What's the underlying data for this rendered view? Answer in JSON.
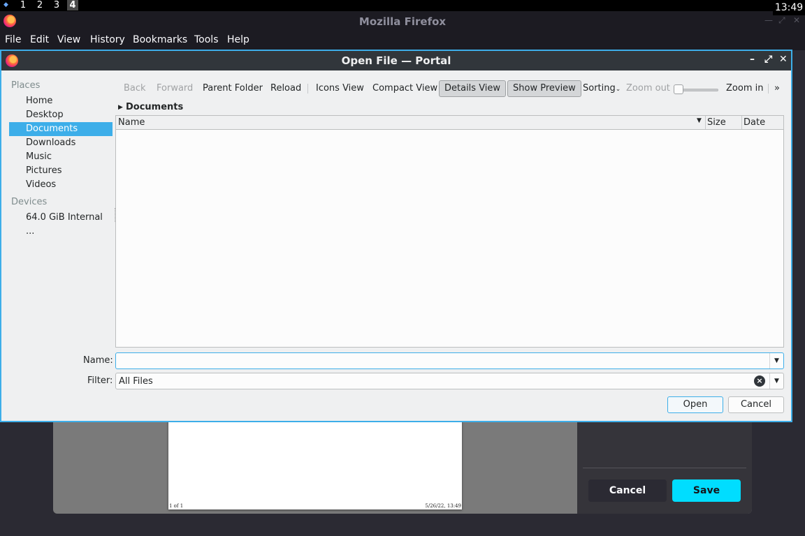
{
  "panel": {
    "workspaces": [
      "1",
      "2",
      "3",
      "4"
    ],
    "active_workspace": "4",
    "clock": "13:49"
  },
  "firefox": {
    "title": "Mozilla Firefox",
    "menu": [
      "File",
      "Edit",
      "View",
      "History",
      "Bookmarks",
      "Tools",
      "Help"
    ]
  },
  "background_page": {
    "footer_left": "1 of 1",
    "footer_right": "5/26/22, 13:49",
    "cancel_label": "Cancel",
    "save_label": "Save",
    "save_color": "#00ddff"
  },
  "dialog": {
    "title": "Open File — Portal",
    "places_header": "Places",
    "places": [
      "Home",
      "Desktop",
      "Documents",
      "Downloads",
      "Music",
      "Pictures",
      "Videos"
    ],
    "selected_place": "Documents",
    "devices_header": "Devices",
    "devices": [
      "64.0 GiB Internal ..."
    ],
    "toolbar": {
      "back": "Back",
      "forward": "Forward",
      "parent": "Parent Folder",
      "reload": "Reload",
      "icons_view": "Icons View",
      "compact_view": "Compact View",
      "details_view": "Details View",
      "show_preview": "Show Preview",
      "sorting": "Sorting",
      "zoom_out": "Zoom out",
      "zoom_in": "Zoom in",
      "more": "»"
    },
    "breadcrumb": "Documents",
    "columns": [
      "Name",
      "Size",
      "Date"
    ],
    "name_label": "Name:",
    "name_value": "",
    "filter_label": "Filter:",
    "filter_value": "All Files",
    "open_label": "Open",
    "cancel_label": "Cancel",
    "accent": "#3daee9"
  }
}
